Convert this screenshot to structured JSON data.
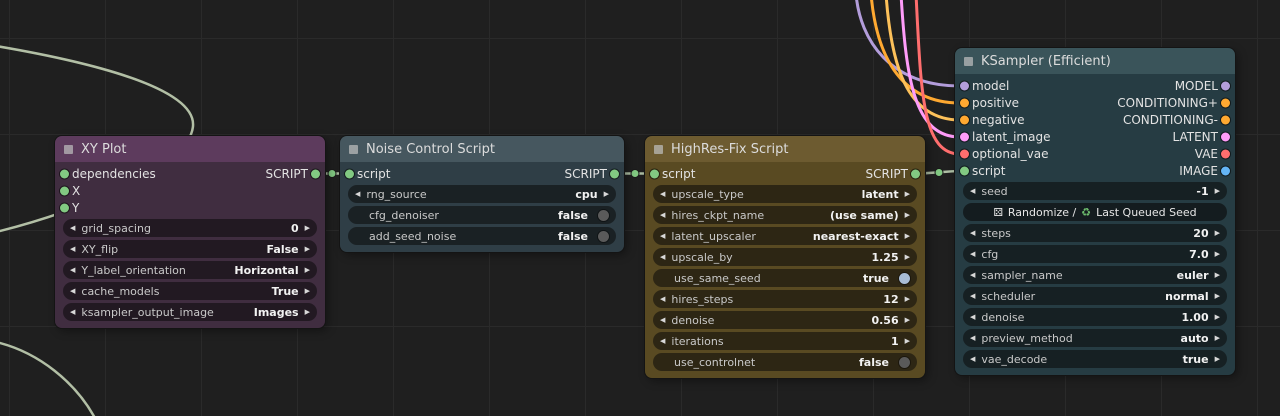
{
  "canvas": {
    "background": "#1f1f1f",
    "grid_color": "#2a2a2a"
  },
  "colors": {
    "script_slot": "#82c982",
    "wire_sage": "#b2bfa5",
    "model": "#b39ddb",
    "conditioning": "#ffa931",
    "latent": "#ff9cf9",
    "vae": "#ff6e6e",
    "image": "#64b5f6",
    "toggle_on": "#a9bdd6",
    "toggle_off": "#5a5a5a"
  },
  "icons": {
    "decrement": "◀",
    "increment": "▶"
  },
  "nodes": {
    "xy_plot": {
      "title": "XY Plot",
      "inputs": [
        {
          "label": "dependencies"
        },
        {
          "label": "X"
        },
        {
          "label": "Y"
        }
      ],
      "outputs": [
        {
          "label": "SCRIPT"
        }
      ],
      "widgets": [
        {
          "label": "grid_spacing",
          "value": "0"
        },
        {
          "label": "XY_flip",
          "value": "False"
        },
        {
          "label": "Y_label_orientation",
          "value": "Horizontal"
        },
        {
          "label": "cache_models",
          "value": "True"
        },
        {
          "label": "ksampler_output_image",
          "value": "Images"
        }
      ]
    },
    "noise_control": {
      "title": "Noise Control Script",
      "inputs": [
        {
          "label": "script"
        }
      ],
      "outputs": [
        {
          "label": "SCRIPT"
        }
      ],
      "widgets": [
        {
          "label": "rng_source",
          "value": "cpu"
        },
        {
          "label": "cfg_denoiser",
          "value": "false"
        },
        {
          "label": "add_seed_noise",
          "value": "false"
        }
      ]
    },
    "highres_fix": {
      "title": "HighRes-Fix Script",
      "inputs": [
        {
          "label": "script"
        }
      ],
      "outputs": [
        {
          "label": "SCRIPT"
        }
      ],
      "widgets": [
        {
          "label": "upscale_type",
          "value": "latent"
        },
        {
          "label": "hires_ckpt_name",
          "value": "(use same)"
        },
        {
          "label": "latent_upscaler",
          "value": "nearest-exact"
        },
        {
          "label": "upscale_by",
          "value": "1.25"
        },
        {
          "label": "use_same_seed",
          "value": "true"
        },
        {
          "label": "hires_steps",
          "value": "12"
        },
        {
          "label": "denoise",
          "value": "0.56"
        },
        {
          "label": "iterations",
          "value": "1"
        },
        {
          "label": "use_controlnet",
          "value": "false"
        }
      ]
    },
    "ksampler": {
      "title": "KSampler (Efficient)",
      "inputs": [
        {
          "label": "model"
        },
        {
          "label": "positive"
        },
        {
          "label": "negative"
        },
        {
          "label": "latent_image"
        },
        {
          "label": "optional_vae"
        },
        {
          "label": "script"
        }
      ],
      "outputs": [
        {
          "label": "MODEL"
        },
        {
          "label": "CONDITIONING+"
        },
        {
          "label": "CONDITIONING-"
        },
        {
          "label": "LATENT"
        },
        {
          "label": "VAE"
        },
        {
          "label": "IMAGE"
        }
      ],
      "widgets": [
        {
          "label": "seed",
          "value": "-1"
        },
        {
          "label": "steps",
          "value": "20"
        },
        {
          "label": "cfg",
          "value": "7.0"
        },
        {
          "label": "sampler_name",
          "value": "euler"
        },
        {
          "label": "scheduler",
          "value": "normal"
        },
        {
          "label": "denoise",
          "value": "1.00"
        },
        {
          "label": "preview_method",
          "value": "auto"
        },
        {
          "label": "vae_decode",
          "value": "true"
        }
      ],
      "seed_button": {
        "icon_left": "⚄",
        "text_left": "Randomize /",
        "icon_right": "♻",
        "text_right": "Last Queued Seed"
      }
    }
  }
}
